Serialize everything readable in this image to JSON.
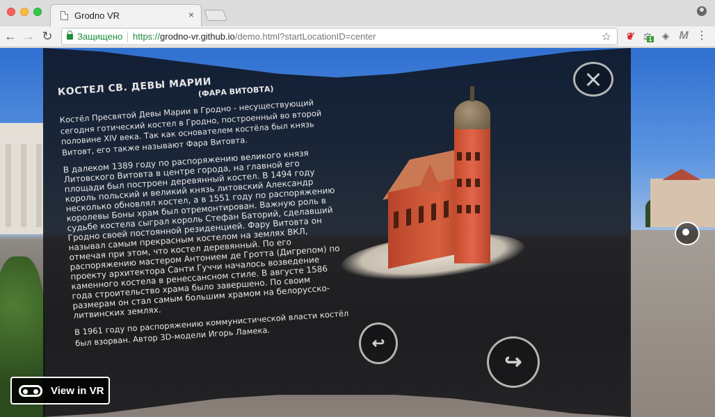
{
  "browser": {
    "tab_title": "Grodno VR",
    "tab_close": "×",
    "secure_label": "Защищено",
    "url_protocol": "https://",
    "url_host": "grodno-vr.github.io",
    "url_path": "/demo.html?startLocationID=center",
    "nav": {
      "back": "←",
      "forward": "→",
      "reload": "↻"
    },
    "star": "☆",
    "extensions": {
      "a": "❦",
      "b": "⚖",
      "b_badge": "1",
      "c": "◈",
      "d": "M",
      "menu": "⋮"
    },
    "accent_color": "#1e8e3e"
  },
  "panel": {
    "title": "КОСТЕЛ СВ. ДЕВЫ МАРИИ",
    "subtitle": "(ФАРА ВИТОВТА)",
    "paragraphs": [
      "Костёл Пресвятой Девы Марии в Гродно - несуществующий сегодня готический костел в Гродно, построенный во второй половине XIV века. Так как основателем костёла был князь Витовт, его также называют Фара Витовта.",
      "В далеком 1389 году по распоряжению великого князя Литовского Витовта в центре города, на главной его площади был построен деревянный костел. В 1494 году король польский и великий князь литовский Александр несколько обновлял костел, а в 1551 году по распоряжению королевы Боны храм был отремонтирован. Важную роль в судьбе костела сыграл король Стефан Баторий, сделавший Гродно своей постоянной резиденцией. Фару Витовта он называл самым прекрасным костелом на землях ВКЛ, отмечая при этом, что костел деревянный. По его распоряжению мастером Антонием де Гротта (Дигрепом) по проекту архитектора Санти Гуччи началось возведение каменного костела в ренессансном стиле. В августе 1586 года строительство храма было завершено. По своим размерам он стал самым большим храмом на белорусско-литвинских землях.",
      "В 1961 году по распоряжению коммунистической власти костёл был взорван. Автор 3D-модели Игорь Ламека."
    ]
  },
  "controls": {
    "prev_arrow": "↩",
    "next_arrow": "↪",
    "vr_button_label": "View in VR"
  }
}
